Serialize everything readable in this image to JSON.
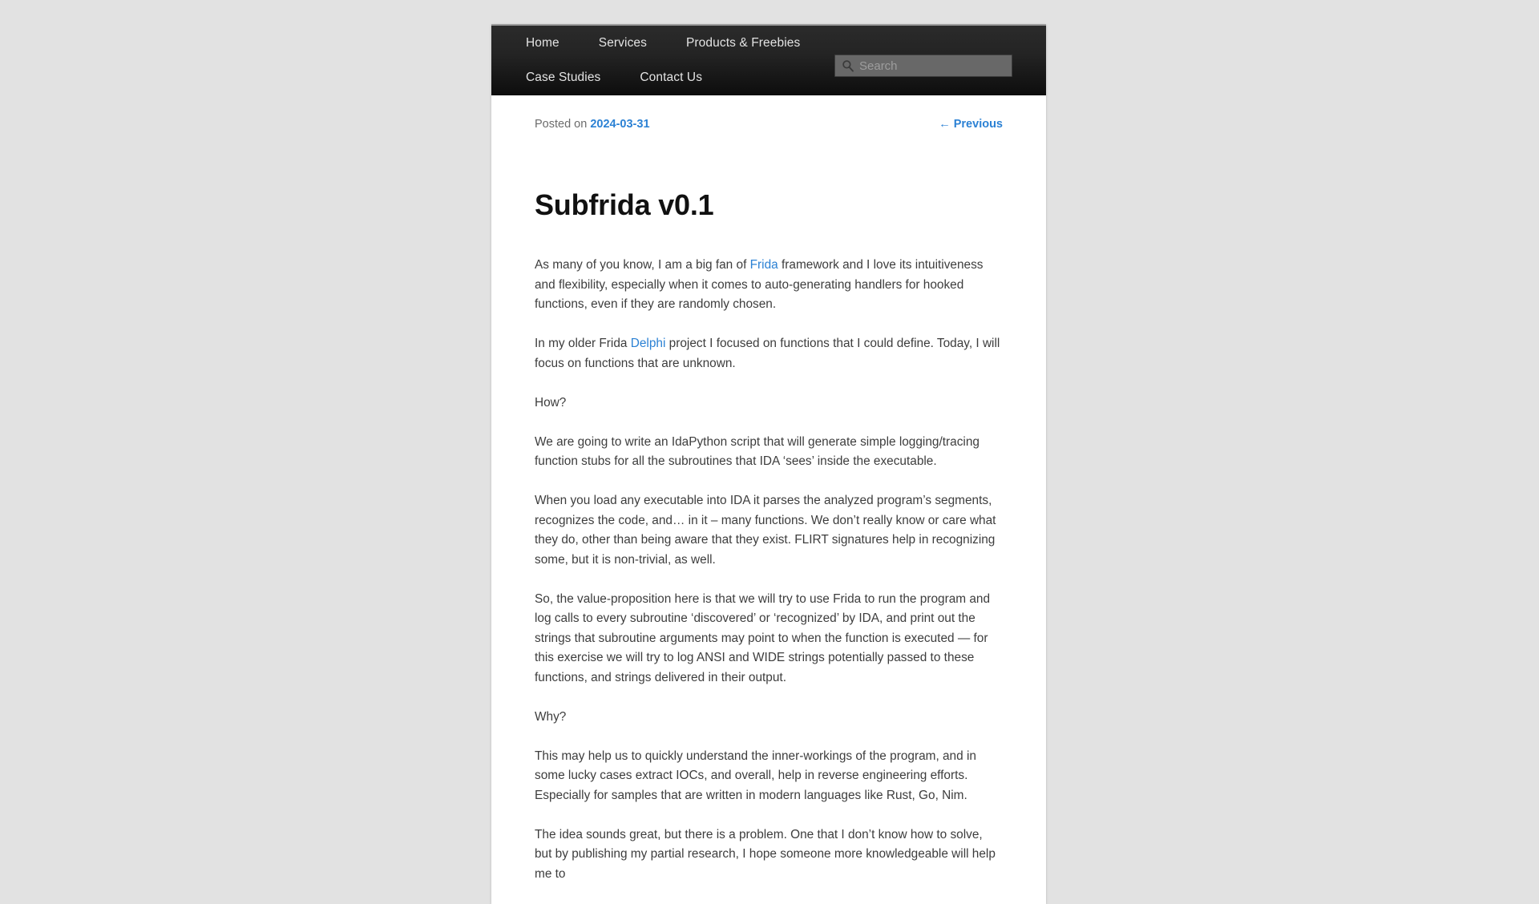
{
  "nav": {
    "rows": [
      [
        {
          "label": "Home",
          "name": "nav-item-home"
        },
        {
          "label": "Services",
          "name": "nav-item-services"
        },
        {
          "label": "Products & Freebies",
          "name": "nav-item-products-freebies"
        }
      ],
      [
        {
          "label": "Case Studies",
          "name": "nav-item-case-studies"
        },
        {
          "label": "Contact Us",
          "name": "nav-item-contact-us"
        }
      ]
    ]
  },
  "search": {
    "placeholder": "Search",
    "value": "",
    "icon": "search-icon"
  },
  "post": {
    "posted_on_label": "Posted on",
    "date": "2024-03-31",
    "previous_label": "← Previous",
    "title": "Subfrida v0.1",
    "paragraphs": [
      {
        "parts": [
          {
            "text": "As many of you know, I am a big fan of ",
            "link": false
          },
          {
            "text": "Frida",
            "link": true
          },
          {
            "text": " framework and I love its intuitiveness and flexibility, especially when it comes to auto-generating handlers for hooked functions, even if they are randomly chosen.",
            "link": false
          }
        ]
      },
      {
        "parts": [
          {
            "text": "In my older Frida ",
            "link": false
          },
          {
            "text": "Delphi",
            "link": true
          },
          {
            "text": " project I focused on functions that I could define. Today, I will focus on functions that are unknown.",
            "link": false
          }
        ]
      },
      {
        "parts": [
          {
            "text": "How?",
            "link": false
          }
        ]
      },
      {
        "parts": [
          {
            "text": "We are going to write an IdaPython script that will generate simple logging/tracing function stubs for all the subroutines that IDA ‘sees’ inside the executable.",
            "link": false
          }
        ]
      },
      {
        "parts": [
          {
            "text": "When you load any executable into IDA it parses the analyzed program’s segments, recognizes the code, and… in it – many functions. We don’t really know or care what they do, other than being aware that they exist. FLIRT signatures help in recognizing some, but it is non-trivial, as well.",
            "link": false
          }
        ]
      },
      {
        "parts": [
          {
            "text": "So, the value-proposition here is that we will try to use Frida to run the program and log calls to every subroutine ‘discovered’ or ‘recognized’ by IDA, and print out the strings that subroutine arguments may point to when the function is executed — for this exercise we will try to log ANSI and WIDE strings potentially passed to these functions, and strings delivered in their output.",
            "link": false
          }
        ]
      },
      {
        "parts": [
          {
            "text": "Why?",
            "link": false
          }
        ]
      },
      {
        "parts": [
          {
            "text": "This may help us to quickly understand the inner-workings of the program, and in some lucky cases extract IOCs, and overall, help in reverse engineering efforts. Especially for samples that are written in modern languages like Rust, Go, Nim.",
            "link": false
          }
        ]
      },
      {
        "parts": [
          {
            "text": "The idea sounds great, but there is a problem. One that I don’t know how to solve, but by publishing my partial research, I hope someone more knowledgeable will help me to",
            "link": false
          }
        ]
      }
    ]
  },
  "colors": {
    "page_background": "#e2e2e2",
    "masthead_dark": "#1a1a1a",
    "link_blue": "#2b81d4",
    "body_text": "#3d3d3d",
    "meta_text": "#6b6b6b"
  }
}
